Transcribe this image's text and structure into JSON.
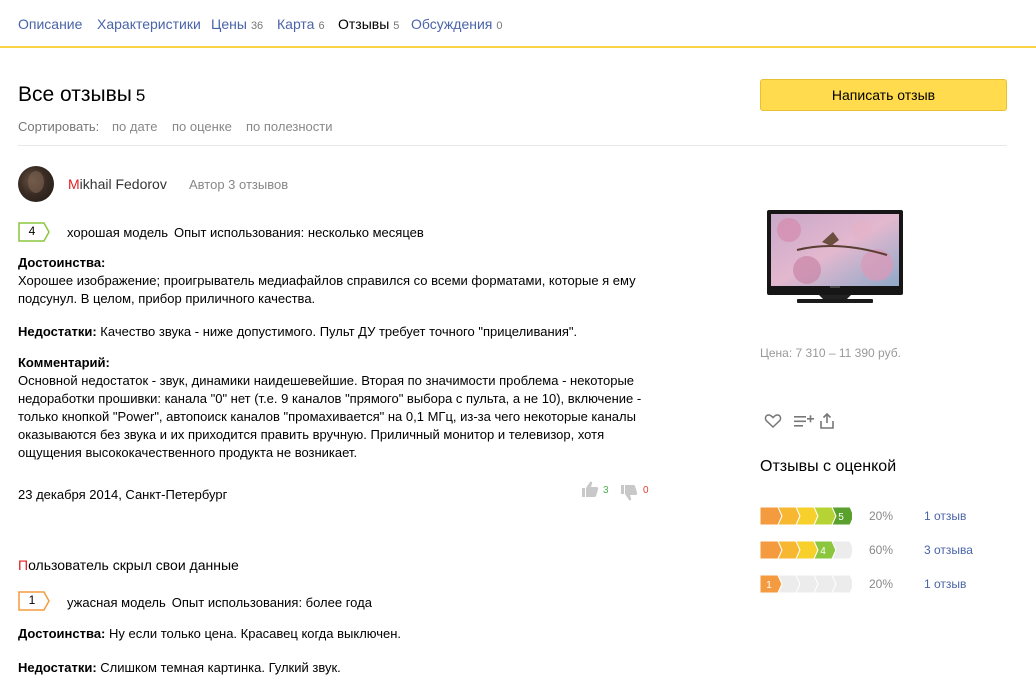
{
  "nav": {
    "tabs": [
      {
        "label": "Описание",
        "count": ""
      },
      {
        "label": "Характеристики",
        "count": ""
      },
      {
        "label": "Цены",
        "count": "36"
      },
      {
        "label": "Карта",
        "count": "6"
      },
      {
        "label": "Отзывы",
        "count": "5"
      },
      {
        "label": "Обсуждения",
        "count": "0"
      }
    ]
  },
  "header": {
    "title": "Все отзывы",
    "count": "5",
    "sort_label": "Сортировать:",
    "sort_options": [
      "по дате",
      "по оценке",
      "по полезности"
    ],
    "write_button": "Написать отзыв"
  },
  "reviews": [
    {
      "author_first": "M",
      "author_rest": "ikhail Fedorov",
      "author_meta": "Автор 3 отзывов",
      "rating": "4",
      "summary": "хорошая модель",
      "experience": "Опыт использования: несколько месяцев",
      "pros_label": "Достоинства:",
      "pros_lines": [
        "Хорошее изображение; проигрыватель медиафайлов справился со всеми форматами, которые я ему",
        "подсунул. В целом, прибор приличного качества."
      ],
      "cons_label": "Недостатки:",
      "cons": "Качество звука - ниже допустимого. Пульт ДУ требует точного \"прицеливания\".",
      "comment_label": "Комментарий:",
      "comment_lines": [
        "Основной недостаток - звук, динамики наидешевейшие. Вторая по значимости проблема - некоторые",
        "недоработки прошивки: канала \"0\" нет (т.е. 9 каналов \"прямого\" выбора с пульта, а не 10), включение -",
        "только кнопкой \"Power\", автопоиск каналов \"промахивается\" на 0,1 МГц, из-за чего некоторые каналы",
        "оказываются без звука и их приходится править вручную. Приличный монитор и телевизор, хотя",
        "ощущения высококачественного продукта не возникает."
      ],
      "date": "23 декабря 2014, Санкт-Петербург",
      "likes": "3",
      "dislikes": "0"
    },
    {
      "author_first": "П",
      "author_rest": "ользователь скрыл свои данные",
      "rating": "1",
      "summary": "ужасная модель",
      "experience": "Опыт использования: более года",
      "pros_label": "Достоинства:",
      "pros": "Ну если только цена. Красавец когда выключен.",
      "cons_label": "Недостатки:",
      "cons": "Слишком темная картинка. Гулкий звук."
    }
  ],
  "sidebar": {
    "price": "Цена: 7 310 – 11 390 руб.",
    "icons": [
      "heart-icon",
      "add-to-list-icon",
      "share-icon"
    ],
    "rated_title": "Отзывы с оценкой",
    "histogram": [
      {
        "rating": "5",
        "level": 5,
        "percent": "20%",
        "link": "1 отзыв",
        "color": "#5aa02c"
      },
      {
        "rating": "4",
        "level": 4,
        "percent": "60%",
        "link": "3 отзыва",
        "color": "#8cc63f"
      },
      {
        "rating": "1",
        "level": 1,
        "percent": "20%",
        "link": "1 отзыв",
        "color": "#f49b3f"
      }
    ]
  },
  "colors": {
    "accent": "#ffdb4d",
    "nav_border": "#f8d343",
    "link": "#4a64a8",
    "rating_4": "#8cc63f",
    "rating_1": "#f49b3f"
  }
}
